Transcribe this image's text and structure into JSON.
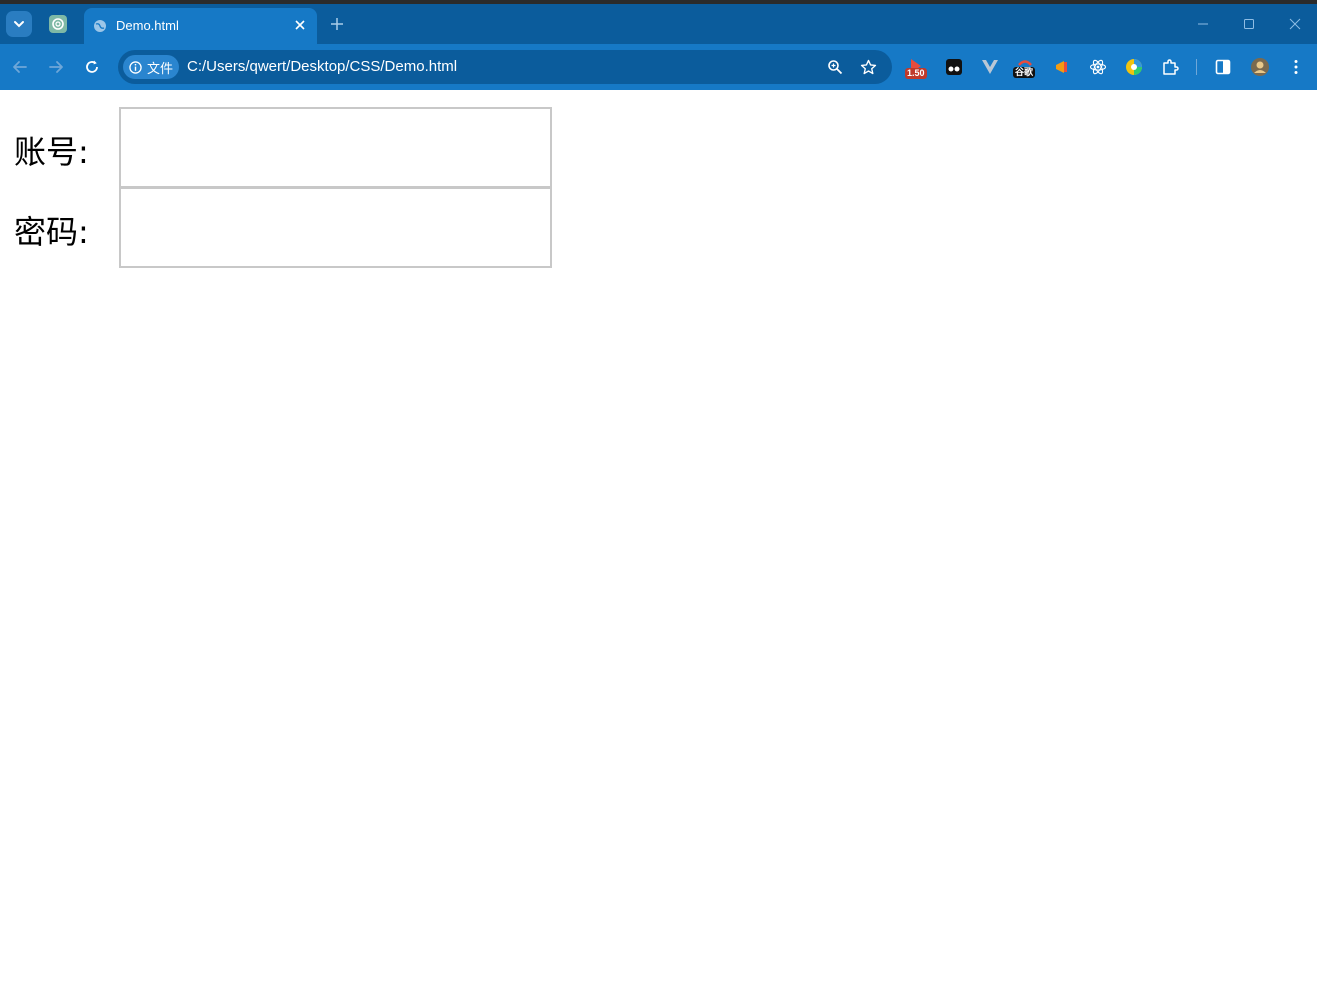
{
  "browser": {
    "tab_title": "Demo.html",
    "site_chip_label": "文件",
    "url": "C:/Users/qwert/Desktop/CSS/Demo.html",
    "accent_color": "#1679c6",
    "frame_color": "#0b5c9c"
  },
  "extensions": {
    "speed_badge": "1.50",
    "translate_badge": "谷歌"
  },
  "form": {
    "account_label": "账号:",
    "account_value": "",
    "password_label": "密码:",
    "password_value": ""
  },
  "icons": {
    "tab_search": "chevron-down-icon",
    "close_tab": "close-icon",
    "new_tab": "plus-icon",
    "back": "arrow-left-icon",
    "forward": "arrow-right-icon",
    "reload": "reload-icon",
    "zoom": "zoom-icon",
    "bookmark": "star-icon",
    "extensions": "puzzle-icon",
    "side_panel": "side-panel-icon",
    "menu": "kebab-menu-icon"
  }
}
